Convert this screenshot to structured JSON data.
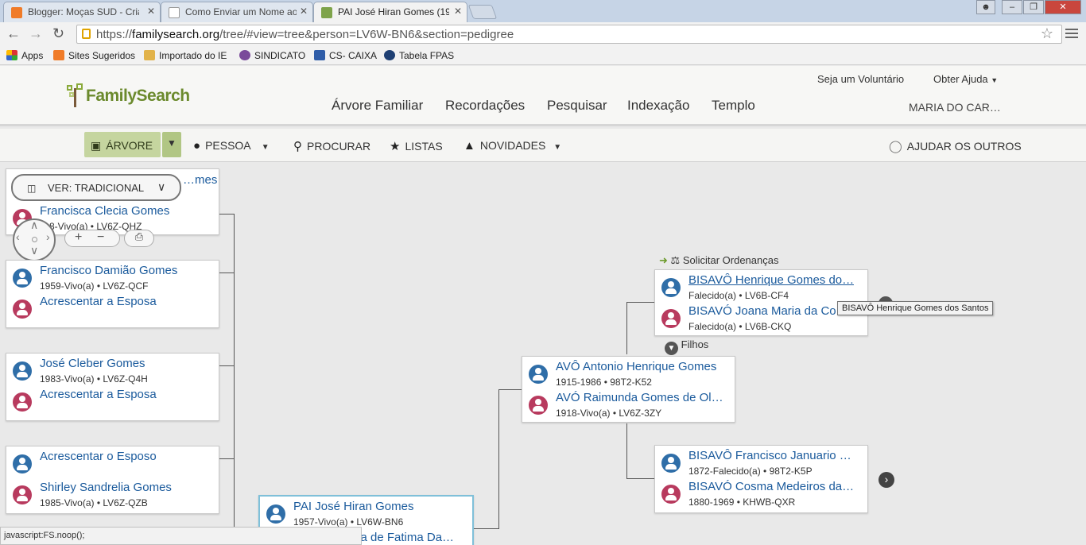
{
  "browser": {
    "tabs": [
      {
        "title": "Blogger: Moças SUD - Cria",
        "color": "#f07b28"
      },
      {
        "title": "Como Enviar um Nome ao",
        "color": "#ffffff"
      },
      {
        "title": "PAI José Hiran Gomes (19",
        "color": "#7ea34a"
      }
    ],
    "tab_close": "✕",
    "url_scheme": "https://",
    "url_host": "familysearch.org",
    "url_path": "/tree/#view=tree&person=LV6W-BN6&section=pedigree",
    "bookmarks": [
      {
        "label": "Apps",
        "color": "#d33"
      },
      {
        "label": "Sites Sugeridos",
        "color": "#f07b28"
      },
      {
        "label": "Importado do IE",
        "color": "#e2b34a"
      },
      {
        "label": "SINDICATO",
        "color": "#7a4a9a"
      },
      {
        "label": "CS- CAIXA",
        "color": "#2f5da8"
      },
      {
        "label": "Tabela FPAS",
        "color": "#1e3f73"
      }
    ],
    "status_text": "javascript:FS.noop();"
  },
  "header": {
    "logo": "FamilySearch",
    "top_links": [
      "Seja um Voluntário",
      "Obter Ajuda"
    ],
    "nav": [
      "Árvore Familiar",
      "Recordações",
      "Pesquisar",
      "Indexação",
      "Templo"
    ],
    "user": "MARIA DO CAR…"
  },
  "subnav": {
    "arvore": "ÁRVORE",
    "pessoa": "PESSOA",
    "procurar": "PROCURAR",
    "listas": "LISTAS",
    "novidades": "NOVIDADES",
    "ajudar": "AJUDAR OS OUTROS"
  },
  "tree": {
    "view_label": "VER: TRADICIONAL",
    "zoom_in": "+",
    "zoom_out": "−",
    "children": [
      {
        "top_name": "Francisca Clecia Gomes",
        "top_info": "…8-Vivo(a)  •  LV6Z-QHZ",
        "hidden_name": "…mes"
      },
      {
        "top_name": "Francisco Damião Gomes",
        "top_info": "1959-Vivo(a)  •  LV6Z-QCF",
        "bottom_name": "Acrescentar a Esposa"
      },
      {
        "top_name": "José Cleber Gomes",
        "top_info": "1983-Vivo(a)  •  LV6Z-Q4H",
        "bottom_name": "Acrescentar a Esposa"
      },
      {
        "top_name": "Acrescentar o Esposo",
        "bottom_name": "Shirley Sandrelia Gomes",
        "bottom_info": "1985-Vivo(a)  •  LV6Z-QZB"
      }
    ],
    "focus": {
      "top_name": "PAI José Hiran Gomes",
      "top_info": "1957-Vivo(a)  •  LV6W-BN6",
      "bottom_name": "…ca de Fatima Da…"
    },
    "grandparents": {
      "top_name": "AVÔ Antonio Henrique Gomes",
      "top_info": "1915-1986  •  98T2-K52",
      "bottom_name": "AVÓ Raimunda Gomes de Ol…",
      "bottom_info": "1918-Vivo(a)  •  LV6Z-3ZY"
    },
    "greatgp1": {
      "top_name": "BISAVÔ Henrique Gomes do…",
      "top_info": "Falecido(a)  •  LV6B-CF4",
      "bottom_name": "BISAVÓ Joana Maria da Co…",
      "bottom_info": "Falecido(a)  •  LV6B-CKQ"
    },
    "greatgp2": {
      "top_name": "BISAVÔ Francisco Januario …",
      "top_info": "1872-Falecido(a)  •  98T2-K5P",
      "bottom_name": "BISAVÓ Cosma Medeiros da…",
      "bottom_info": "1880-1969  •  KHWB-QXR"
    },
    "ordinances": "Solicitar Ordenanças",
    "filhos": "Filhos",
    "tooltip": "BISAVÔ Henrique Gomes dos Santos"
  }
}
